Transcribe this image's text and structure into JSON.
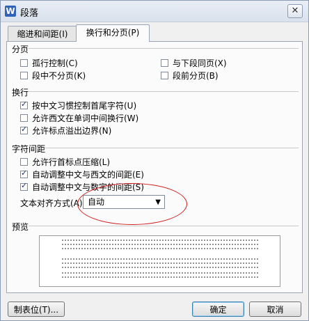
{
  "window": {
    "title": "段落",
    "close_label": "✕"
  },
  "tabs": [
    {
      "label": "缩进和间距(I)",
      "active": false
    },
    {
      "label": "换行和分页(P)",
      "active": true
    }
  ],
  "sections": {
    "pagination": {
      "title": "分页",
      "options": [
        {
          "label": "孤行控制(C)",
          "checked": false
        },
        {
          "label": "与下段同页(X)",
          "checked": false
        },
        {
          "label": "段中不分页(K)",
          "checked": false
        },
        {
          "label": "段前分页(B)",
          "checked": false
        }
      ]
    },
    "line_break": {
      "title": "换行",
      "options": [
        {
          "label": "按中文习惯控制首尾字符(U)",
          "checked": true
        },
        {
          "label": "允许西文在单词中间换行(W)",
          "checked": false
        },
        {
          "label": "允许标点溢出边界(N)",
          "checked": true
        }
      ]
    },
    "char_spacing": {
      "title": "字符间距",
      "options": [
        {
          "label": "允许行首标点压缩(L)",
          "checked": false
        },
        {
          "label": "自动调整中文与西文的间距(E)",
          "checked": true
        },
        {
          "label": "自动调整中文与数字的间距(S)",
          "checked": true
        }
      ],
      "align_label": "文本对齐方式(A):",
      "align_value": "自动"
    },
    "preview": {
      "title": "预览"
    }
  },
  "buttons": {
    "tabs_label": "制表位(T)...",
    "ok_label": "确定",
    "cancel_label": "取消"
  },
  "annotation_color": "#d11d1d"
}
